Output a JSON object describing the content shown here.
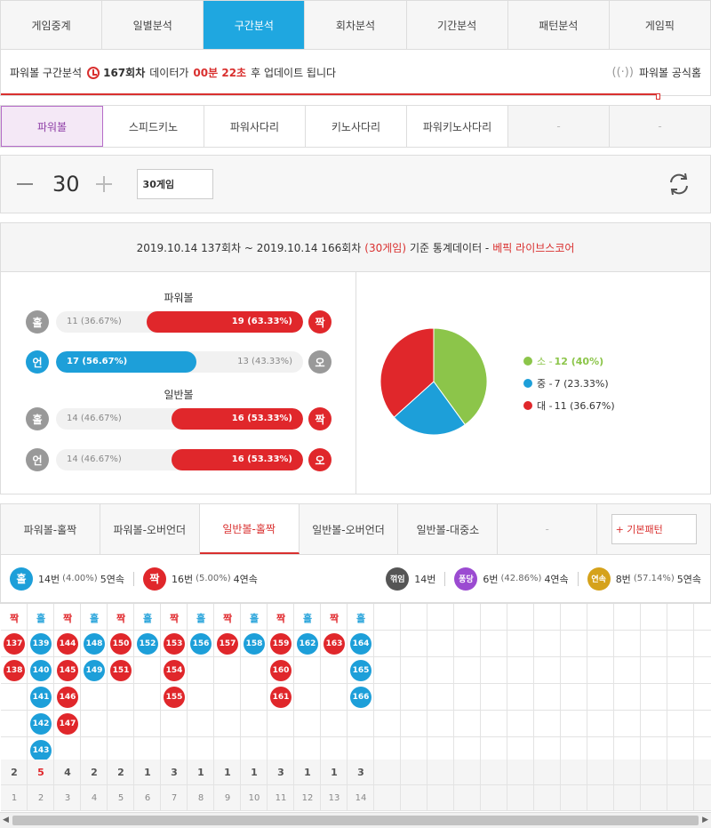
{
  "main_tabs": [
    "게임중계",
    "일별분석",
    "구간분석",
    "회차분석",
    "기간분석",
    "패턴분석",
    "게임픽"
  ],
  "active_main_tab": 2,
  "notice": {
    "prefix": "파워볼 구간분석",
    "round": "167회차",
    "mid": "데이터가",
    "time": "00분 22초",
    "suffix": "후 업데이트 됩니다",
    "official": "파워볼 공식홈"
  },
  "game_tabs": [
    "파워볼",
    "스피드키노",
    "파워사다리",
    "키노사다리",
    "파워키노사다리",
    "-",
    "-"
  ],
  "active_game_tab": 0,
  "counter": {
    "value": "30",
    "select": "30게임"
  },
  "summary": {
    "main": "2019.10.14 137회차 ~ 2019.10.14 166회차",
    "games": "(30게임)",
    "mid": "기준 통계데이터 -",
    "brand": "베픽 라이브스코어"
  },
  "powerball_title": "파워볼",
  "normal_title": "일반볼",
  "stat_rows": [
    {
      "left_icon": "홀",
      "left_color": "gray",
      "right_icon": "짝",
      "right_color": "red",
      "left_label": "11 (36.67%)",
      "right_label": "19 (63.33%)",
      "fill_side": "right",
      "fill_ratio": 0.6333,
      "fill_color": "red"
    },
    {
      "left_icon": "언",
      "left_color": "blue",
      "right_icon": "오",
      "right_color": "gray",
      "left_label": "17 (56.67%)",
      "right_label": "13 (43.33%)",
      "fill_side": "left",
      "fill_ratio": 0.5667,
      "fill_color": "blue"
    },
    {
      "left_icon": "홀",
      "left_color": "gray",
      "right_icon": "짝",
      "right_color": "red",
      "left_label": "14 (46.67%)",
      "right_label": "16 (53.33%)",
      "fill_side": "right",
      "fill_ratio": 0.5333,
      "fill_color": "red"
    },
    {
      "left_icon": "언",
      "left_color": "gray",
      "right_icon": "오",
      "right_color": "red",
      "left_label": "14 (46.67%)",
      "right_label": "16 (53.33%)",
      "fill_side": "right",
      "fill_ratio": 0.5333,
      "fill_color": "red"
    }
  ],
  "chart_data": {
    "type": "pie",
    "categories": [
      "소",
      "중",
      "대"
    ],
    "values": [
      12,
      7,
      11
    ],
    "percent_labels": [
      "12 (40%)",
      "7 (23.33%)",
      "11 (36.67%)"
    ],
    "colors": [
      "#8cc54a",
      "#1d9fd9",
      "#e0272b"
    ],
    "legend_position": "right"
  },
  "pattern_tabs": [
    "파워볼-홀짝",
    "파워볼-오버언더",
    "일반볼-홀짝",
    "일반볼-오버언더",
    "일반볼-대중소",
    "-"
  ],
  "active_pattern_tab": 2,
  "basic_pattern_label": "+ 기본패턴",
  "info": {
    "odd_icon": "홀",
    "odd_text": "14번",
    "odd_pct": "(4.00%)",
    "odd_streak": "5연속",
    "even_icon": "짝",
    "even_text": "16번",
    "even_pct": "(5.00%)",
    "even_streak": "4연속",
    "break_icon": "꺾임",
    "break_text": "14번",
    "pong_icon": "퐁당",
    "pong_text": "6번",
    "pong_pct": "(42.86%)",
    "pong_streak": "4연속",
    "cont_icon": "연속",
    "cont_text": "8번",
    "cont_pct": "(57.14%)",
    "cont_streak": "5연속"
  },
  "pattern_columns": [
    {
      "type": "짝",
      "rounds": [
        "137",
        "138"
      ]
    },
    {
      "type": "홀",
      "rounds": [
        "139",
        "140",
        "141",
        "142",
        "143"
      ]
    },
    {
      "type": "짝",
      "rounds": [
        "144",
        "145",
        "146",
        "147"
      ]
    },
    {
      "type": "홀",
      "rounds": [
        "148",
        "149"
      ]
    },
    {
      "type": "짝",
      "rounds": [
        "150",
        "151"
      ]
    },
    {
      "type": "홀",
      "rounds": [
        "152"
      ]
    },
    {
      "type": "짝",
      "rounds": [
        "153",
        "154",
        "155"
      ]
    },
    {
      "type": "홀",
      "rounds": [
        "156"
      ]
    },
    {
      "type": "짝",
      "rounds": [
        "157"
      ]
    },
    {
      "type": "홀",
      "rounds": [
        "158"
      ]
    },
    {
      "type": "짝",
      "rounds": [
        "159",
        "160",
        "161"
      ]
    },
    {
      "type": "홀",
      "rounds": [
        "162"
      ]
    },
    {
      "type": "짝",
      "rounds": [
        "163"
      ]
    },
    {
      "type": "홀",
      "rounds": [
        "164",
        "165",
        "166"
      ]
    }
  ],
  "column_counts": [
    "2",
    "5",
    "4",
    "2",
    "2",
    "1",
    "3",
    "1",
    "1",
    "1",
    "3",
    "1",
    "1",
    "3"
  ],
  "column_index": [
    "1",
    "2",
    "3",
    "4",
    "5",
    "6",
    "7",
    "8",
    "9",
    "10",
    "11",
    "12",
    "13",
    "14"
  ],
  "colors": {
    "accent": "#1fa7e0",
    "red": "#e0272b",
    "blue": "#1d9fd9",
    "purple": "#8e3ea6"
  }
}
